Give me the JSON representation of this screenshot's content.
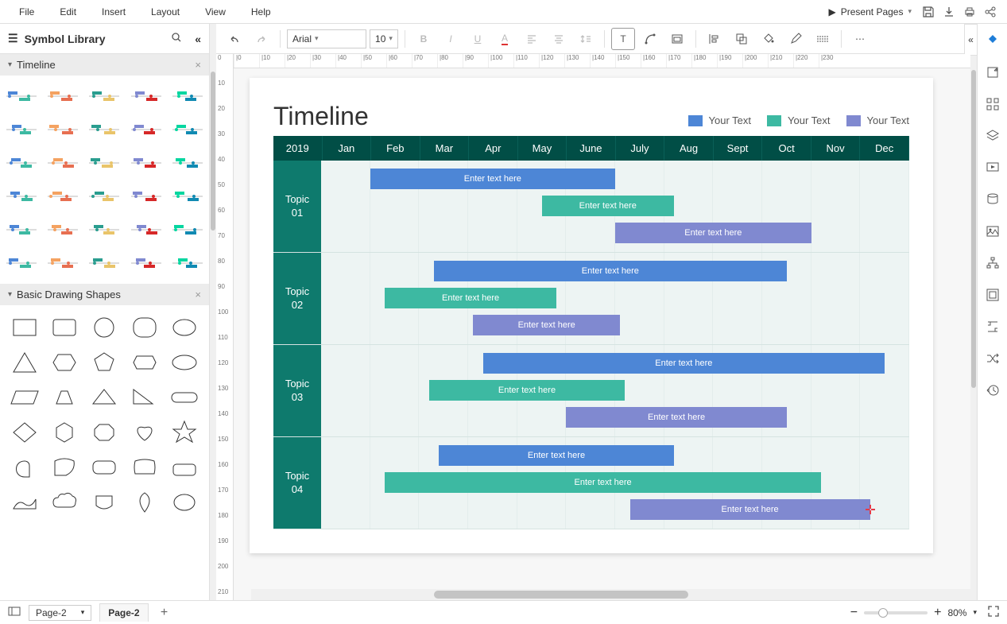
{
  "menu": {
    "items": [
      "File",
      "Edit",
      "Insert",
      "Layout",
      "View",
      "Help"
    ],
    "present": "Present Pages"
  },
  "sidebar": {
    "title": "Symbol Library",
    "sections": {
      "timeline": "Timeline",
      "shapes": "Basic Drawing Shapes"
    }
  },
  "toolbar": {
    "font": "Arial",
    "size": "10"
  },
  "ruler_h": [
    "|0",
    "|10",
    "|20",
    "|30",
    "|40",
    "|50",
    "|60",
    "|70",
    "|80",
    "|90",
    "|100",
    "|110",
    "|120",
    "|130",
    "|140",
    "|150",
    "|160",
    "|170",
    "|180",
    "|190",
    "|200",
    "|210",
    "|220",
    "|230"
  ],
  "ruler_v": [
    "0",
    "10",
    "20",
    "30",
    "40",
    "50",
    "60",
    "70",
    "80",
    "90",
    "100",
    "110",
    "120",
    "130",
    "140",
    "150",
    "160",
    "170",
    "180",
    "190",
    "200",
    "210"
  ],
  "chart_data": {
    "type": "bar",
    "title": "Timeline",
    "year": "2019",
    "categories": [
      "Jan",
      "Feb",
      "Mar",
      "Apr",
      "May",
      "June",
      "July",
      "Aug",
      "Sept",
      "Oct",
      "Nov",
      "Dec"
    ],
    "legend": [
      {
        "label": "Your Text",
        "color": "#4d86d6"
      },
      {
        "label": "Your Text",
        "color": "#3db9a2"
      },
      {
        "label": "Your Text",
        "color": "#8089d0"
      }
    ],
    "series": [
      {
        "name": "Topic 01",
        "bars": [
          {
            "start": 1,
            "end": 6,
            "color": "#4d86d6",
            "text": "Enter text here"
          },
          {
            "start": 4.5,
            "end": 7.2,
            "color": "#3db9a2",
            "text": "Enter text here"
          },
          {
            "start": 6,
            "end": 10,
            "color": "#8089d0",
            "text": "Enter text here"
          }
        ]
      },
      {
        "name": "Topic 02",
        "bars": [
          {
            "start": 2.3,
            "end": 9.5,
            "color": "#4d86d6",
            "text": "Enter text here"
          },
          {
            "start": 1.3,
            "end": 4.8,
            "color": "#3db9a2",
            "text": "Enter text here"
          },
          {
            "start": 3.1,
            "end": 6.1,
            "color": "#8089d0",
            "text": "Enter text here"
          }
        ]
      },
      {
        "name": "Topic 03",
        "bars": [
          {
            "start": 3.3,
            "end": 11.5,
            "color": "#4d86d6",
            "text": "Enter text here"
          },
          {
            "start": 2.2,
            "end": 6.2,
            "color": "#3db9a2",
            "text": "Enter text here"
          },
          {
            "start": 5,
            "end": 9.5,
            "color": "#8089d0",
            "text": "Enter text here"
          }
        ]
      },
      {
        "name": "Topic 04",
        "bars": [
          {
            "start": 2.4,
            "end": 7.2,
            "color": "#4d86d6",
            "text": "Enter text here"
          },
          {
            "start": 1.3,
            "end": 10.2,
            "color": "#3db9a2",
            "text": "Enter text here"
          },
          {
            "start": 6.3,
            "end": 11.2,
            "color": "#8089d0",
            "text": "Enter text here"
          }
        ]
      }
    ]
  },
  "status": {
    "page_dropdown": "Page-2",
    "page_tab": "Page-2",
    "zoom": "80%"
  }
}
